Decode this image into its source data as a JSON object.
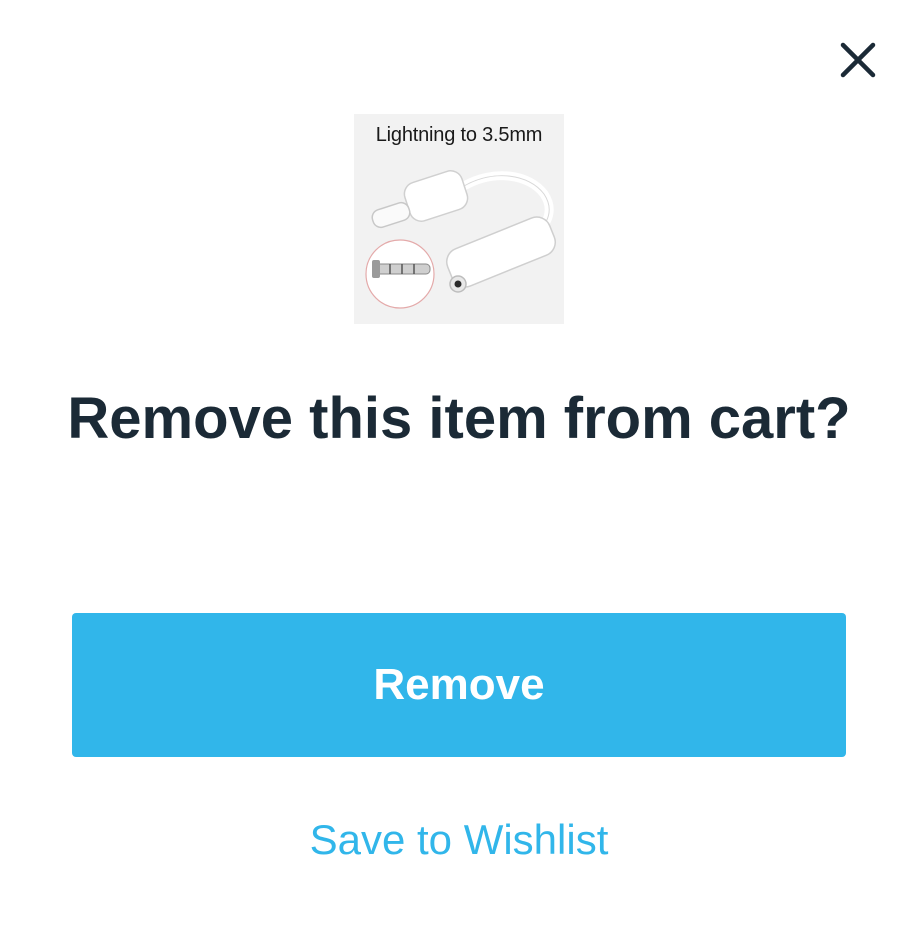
{
  "dialog": {
    "title": "Remove this item from cart?",
    "close_icon": "close-icon",
    "product": {
      "image_caption": "Lightning to 3.5mm"
    },
    "primary_button_label": "Remove",
    "secondary_link_label": "Save to Wishlist"
  },
  "colors": {
    "accent": "#31b6ea",
    "title_text": "#1b2a36",
    "close_icon": "#1b2a36",
    "background": "#ffffff"
  }
}
